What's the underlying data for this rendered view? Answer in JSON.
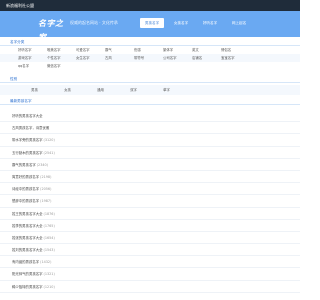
{
  "topbar": {
    "text": "新浪福利社公盟"
  },
  "header": {
    "logo_text": "名字之家",
    "tagline": "权威的起名网站 · 文化传承",
    "nav": [
      {
        "label": "男孩名字",
        "active": true
      },
      {
        "label": "女孩名字",
        "active": false
      },
      {
        "label": "好听名字",
        "active": false
      },
      {
        "label": "网上起名",
        "active": false
      }
    ]
  },
  "category": {
    "title": "名字分类",
    "rows": [
      [
        "好听名字",
        "唯美名字",
        "可爱名字",
        "霸气",
        "伤感",
        "繁体字",
        "英文",
        "情侣名"
      ],
      [
        "游戏名字",
        "个性名字",
        "女生名字",
        "古风",
        "带符号",
        "公司名字",
        "店铺名",
        "宝宝名字"
      ],
      [
        "qq名字",
        "微信名字"
      ]
    ]
  },
  "gender": {
    "title": "性别",
    "items": [
      "男孩",
      "女孩",
      "通用",
      "双字",
      "单字"
    ]
  },
  "list": {
    "title": "最新男孩名字",
    "items": [
      {
        "text": "好听的男孩名字大全",
        "count": ""
      },
      {
        "text": "古风男孩名字，诗意优雅",
        "count": ""
      },
      {
        "text": "带水字旁的男孩名字",
        "count": "(3120)"
      },
      {
        "text": "五行缺木的男孩名字",
        "count": "(2541)"
      },
      {
        "text": "霸气的男孩名字",
        "count": "(2340)"
      },
      {
        "text": "寓意好的男孩名字",
        "count": "(2198)"
      },
      {
        "text": "诗经中的男孩名字",
        "count": "(2056)"
      },
      {
        "text": "楚辞中的男孩名字",
        "count": "(1987)"
      },
      {
        "text": "姓王的男孩名字大全",
        "count": "(1876)"
      },
      {
        "text": "姓李的男孩名字大全",
        "count": "(1765)"
      },
      {
        "text": "姓张的男孩名字大全",
        "count": "(1654)"
      },
      {
        "text": "姓刘的男孩名字大全",
        "count": "(1543)"
      },
      {
        "text": "有内涵的男孩名字",
        "count": "(1432)"
      },
      {
        "text": "阳光帅气的男孩名字",
        "count": "(1321)"
      },
      {
        "text": "稀少独特的男孩名字",
        "count": "(1210)"
      },
      {
        "text": "温文尔雅的男孩名字",
        "count": "(1109)"
      },
      {
        "text": "2024年龙宝宝男孩名字",
        "count": "(1008)"
      }
    ]
  },
  "colors": {
    "topbar": "#1f2c3a",
    "header": "#6aa9f2",
    "accent": "#2a6fd0"
  }
}
